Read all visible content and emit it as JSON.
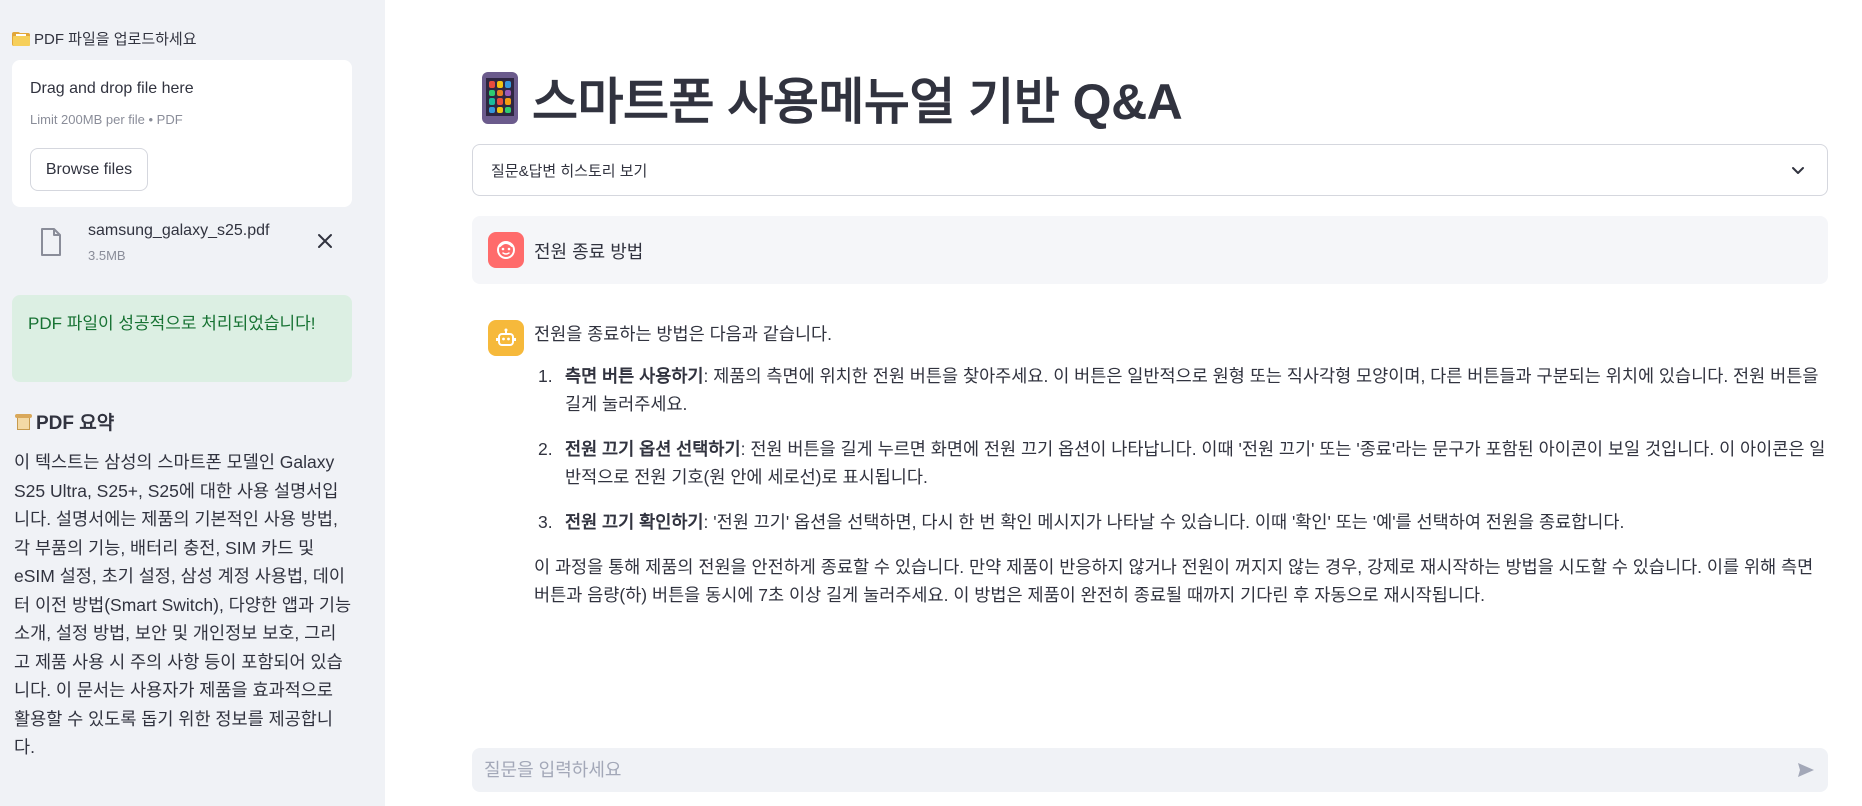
{
  "sidebar": {
    "upload_label": "PDF 파일을 업로드하세요",
    "dropzone": {
      "title": "Drag and drop file here",
      "limit": "Limit 200MB per file • PDF",
      "browse_label": "Browse files"
    },
    "file": {
      "name": "samsung_galaxy_s25.pdf",
      "size": "3.5MB"
    },
    "success_message": "PDF 파일이 성공적으로 처리되었습니다!",
    "summary_title": "PDF 요약",
    "summary_text": "이 텍스트는 삼성의 스마트폰 모델인 Galaxy S25 Ultra, S25+, S25에 대한 사용 설명서입니다. 설명서에는 제품의 기본적인 사용 방법, 각 부품의 기능, 배터리 충전, SIM 카드 및 eSIM 설정, 초기 설정, 삼성 계정 사용법, 데이터 이전 방법(Smart Switch), 다양한 앱과 기능 소개, 설정 방법, 보안 및 개인정보 보호, 그리고 제품 사용 시 주의 사항 등이 포함되어 있습니다. 이 문서는 사용자가 제품을 효과적으로 활용할 수 있도록 돕기 위한 정보를 제공합니다."
  },
  "main": {
    "title": "스마트폰 사용메뉴얼 기반 Q&A",
    "history_expander": "질문&답변 히스토리 보기",
    "user_message": "전원 종료 방법",
    "assistant": {
      "intro": "전원을 종료하는 방법은 다음과 같습니다.",
      "steps": [
        {
          "num": "1.",
          "title": "측면 버튼 사용하기",
          "text": ": 제품의 측면에 위치한 전원 버튼을 찾아주세요. 이 버튼은 일반적으로 원형 또는 직사각형 모양이며, 다른 버튼들과 구분되는 위치에 있습니다. 전원 버튼을 길게 눌러주세요."
        },
        {
          "num": "2.",
          "title": "전원 끄기 옵션 선택하기",
          "text": ": 전원 버튼을 길게 누르면 화면에 전원 끄기 옵션이 나타납니다. 이때 '전원 끄기' 또는 '종료'라는 문구가 포함된 아이콘이 보일 것입니다. 이 아이콘은 일반적으로 전원 기호(원 안에 세로선)로 표시됩니다."
        },
        {
          "num": "3.",
          "title": "전원 끄기 확인하기",
          "text": ": '전원 끄기' 옵션을 선택하면, 다시 한 번 확인 메시지가 나타날 수 있습니다. 이때 '확인' 또는 '예'를 선택하여 전원을 종료합니다."
        }
      ],
      "outro": "이 과정을 통해 제품의 전원을 안전하게 종료할 수 있습니다. 만약 제품이 반응하지 않거나 전원이 꺼지지 않는 경우, 강제로 재시작하는 방법을 시도할 수 있습니다. 이를 위해 측면 버튼과 음량(하) 버튼을 동시에 7초 이상 길게 눌러주세요. 이 방법은 제품이 완전히 종료될 때까지 기다린 후 자동으로 재시작됩니다."
    },
    "chat_placeholder": "질문을 입력하세요"
  },
  "colors": {
    "sidebar_bg": "#f0f2f6",
    "success_bg": "#dcefe3",
    "success_text": "#177233",
    "user_avatar": "#ff6b6b",
    "bot_avatar": "#f6b93b"
  },
  "icons": [
    "folder-icon",
    "file-icon",
    "close-icon",
    "scroll-icon",
    "phone-icon",
    "chevron-down-icon",
    "user-avatar-icon",
    "bot-avatar-icon",
    "send-icon"
  ]
}
